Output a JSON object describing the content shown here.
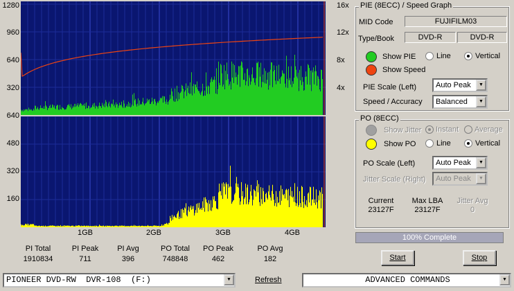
{
  "graph": {
    "pie_y_ticks": [
      "1280",
      "960",
      "640",
      "320",
      "640"
    ],
    "speed_ticks": [
      "16x",
      "12x",
      "8x",
      "4x"
    ],
    "po_y_ticks": [
      "480",
      "320",
      "160"
    ],
    "x_ticks": [
      "1GB",
      "2GB",
      "3GB",
      "4GB"
    ]
  },
  "stats": [
    {
      "label": "PI Total",
      "value": "1910834"
    },
    {
      "label": "PI Peak",
      "value": "711"
    },
    {
      "label": "PI Avg",
      "value": "396"
    },
    {
      "label": "PO Total",
      "value": "748848"
    },
    {
      "label": "PO Peak",
      "value": "462"
    },
    {
      "label": "PO Avg",
      "value": "182"
    }
  ],
  "pie_panel": {
    "title": "PIE (8ECC) / Speed Graph",
    "mid_label": "MID Code",
    "mid_value": "FUJIFILM03",
    "type_label": "Type/Book",
    "type_value": "DVD-R",
    "book_value": "DVD-R",
    "show_pie": "Show PIE",
    "line": "Line",
    "vertical": "Vertical",
    "show_speed": "Show Speed",
    "scale_label": "PIE Scale (Left)",
    "scale_value": "Auto Peak",
    "accuracy_label": "Speed / Accuracy",
    "accuracy_value": "Balanced",
    "pie_color": "#22cc22",
    "speed_color": "#ee4411"
  },
  "po_panel": {
    "title": "PO (8ECC)",
    "show_jitter": "Show Jitter",
    "instant": "Instant",
    "average": "Average",
    "show_po": "Show PO",
    "line": "Line",
    "vertical": "Vertical",
    "scale_label": "PO Scale (Left)",
    "scale_value": "Auto Peak",
    "jitter_scale_label": "Jitter Scale (Right)",
    "jitter_scale_value": "Auto Peak",
    "current_label": "Current",
    "current_value": "23127F",
    "maxlba_label": "Max LBA",
    "maxlba_value": "23127F",
    "jitter_avg_label": "Jitter Avg",
    "jitter_avg_value": "0",
    "po_color": "#ffff00"
  },
  "progress": {
    "label": "100% Complete",
    "percent": 100
  },
  "buttons": {
    "start": "Start",
    "stop": "Stop",
    "refresh": "Refresh"
  },
  "bottom": {
    "drive": "PIONEER DVD-RW  DVR-108  (F:)",
    "commands": "ADVANCED COMMANDS"
  }
}
